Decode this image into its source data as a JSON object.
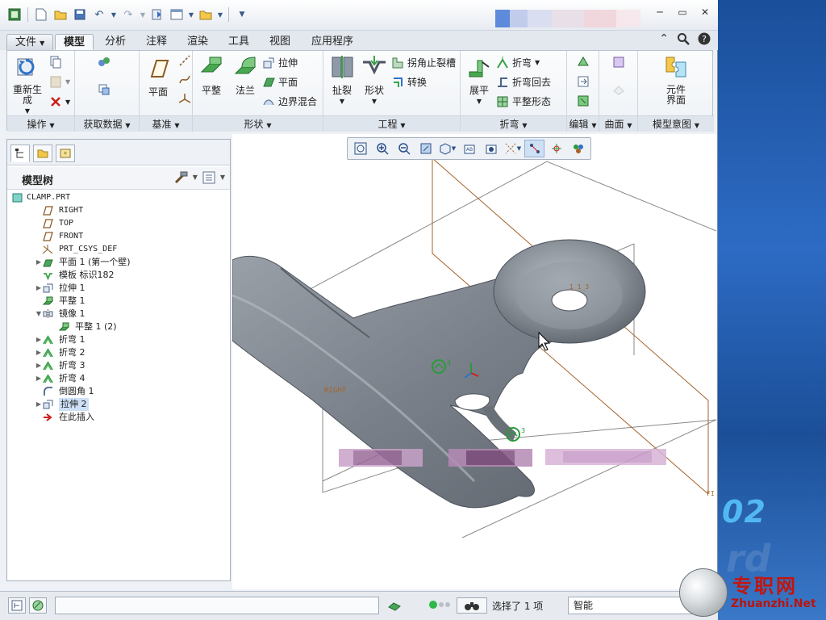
{
  "window": {
    "controls": {
      "minimize": "─",
      "restore": "▭",
      "close": "✕"
    }
  },
  "ribbon": {
    "tabs": [
      "文件",
      "模型",
      "分析",
      "注释",
      "渲染",
      "工具",
      "视图",
      "应用程序"
    ],
    "active_tab": "模型",
    "groups": {
      "operations": {
        "label": "操作",
        "regenerate": "重新生成"
      },
      "get_data": {
        "label": "获取数据"
      },
      "datum": {
        "label": "基准",
        "plane": "平面"
      },
      "shapes": {
        "label": "形状",
        "flat": "平整",
        "flange": "法兰",
        "extrude": "拉伸",
        "plane": "平面",
        "boundary_blend": "边界混合"
      },
      "engineering": {
        "label": "工程",
        "rip": "扯裂",
        "form": "形状",
        "corner_relief": "拐角止裂槽",
        "convert": "转换"
      },
      "bends": {
        "label": "折弯",
        "unbend": "展平",
        "bend": "折弯",
        "bend_back": "折弯回去",
        "flat_pattern": "平整形态"
      },
      "editing": {
        "label": "编辑"
      },
      "surfaces": {
        "label": "曲面"
      },
      "model_intent": {
        "label": "模型意图",
        "component_interface": "元件\n界面"
      }
    }
  },
  "model_tree": {
    "title": "模型树",
    "items": [
      {
        "label": "CLAMP.PRT",
        "expand": "",
        "indent": 0,
        "mono": true,
        "icon": "part-icon"
      },
      {
        "label": "RIGHT",
        "expand": "",
        "indent": 1,
        "mono": true,
        "icon": "datum-plane-icon"
      },
      {
        "label": "TOP",
        "expand": "",
        "indent": 1,
        "mono": true,
        "icon": "datum-plane-icon"
      },
      {
        "label": "FRONT",
        "expand": "",
        "indent": 1,
        "mono": true,
        "icon": "datum-plane-icon"
      },
      {
        "label": "PRT_CSYS_DEF",
        "expand": "",
        "indent": 1,
        "mono": true,
        "icon": "csys-icon"
      },
      {
        "label": "平面 1 (第一个壁)",
        "expand": "▶",
        "indent": 1,
        "mono": false,
        "icon": "sheet-wall-icon"
      },
      {
        "label": "模板 标识182",
        "expand": "",
        "indent": 1,
        "mono": false,
        "icon": "form-template-icon"
      },
      {
        "label": "拉伸 1",
        "expand": "▶",
        "indent": 1,
        "mono": false,
        "icon": "extrude-icon"
      },
      {
        "label": "平整 1",
        "expand": "",
        "indent": 1,
        "mono": false,
        "icon": "flat-wall-icon"
      },
      {
        "label": "镜像 1",
        "expand": "▼",
        "indent": 1,
        "mono": false,
        "icon": "mirror-icon"
      },
      {
        "label": "平整 1 (2)",
        "expand": "",
        "indent": 2,
        "mono": false,
        "icon": "flat-wall-icon"
      },
      {
        "label": "折弯 1",
        "expand": "▶",
        "indent": 1,
        "mono": false,
        "icon": "bend-icon"
      },
      {
        "label": "折弯 2",
        "expand": "▶",
        "indent": 1,
        "mono": false,
        "icon": "bend-icon"
      },
      {
        "label": "折弯 3",
        "expand": "▶",
        "indent": 1,
        "mono": false,
        "icon": "bend-icon"
      },
      {
        "label": "折弯 4",
        "expand": "▶",
        "indent": 1,
        "mono": false,
        "icon": "bend-icon"
      },
      {
        "label": "倒圆角 1",
        "expand": "",
        "indent": 1,
        "mono": false,
        "icon": "round-icon"
      },
      {
        "label": "拉伸 2",
        "expand": "▶",
        "indent": 1,
        "mono": false,
        "icon": "extrude-icon",
        "selected": true
      },
      {
        "label": "在此插入",
        "expand": "",
        "indent": 1,
        "mono": false,
        "icon": "insert-here-arrow-icon"
      }
    ]
  },
  "viewport": {
    "datum_labels": {
      "right": "RIGHT",
      "top": "1_1_3",
      "front": "FI"
    },
    "marker_4": "4",
    "marker_3": "3"
  },
  "status_bar": {
    "selection_text": "选择了 1 项",
    "filter_value": "智能"
  },
  "desktop": {
    "number_text": "02",
    "ghost_text": "rd"
  },
  "watermark": {
    "brand": "专职网",
    "url": "Zhuanzhi.Net"
  },
  "colors": {
    "datum_orange": "#a5632b",
    "part_gray": "#7f858d",
    "accent_blue": "#2a5ca8"
  }
}
